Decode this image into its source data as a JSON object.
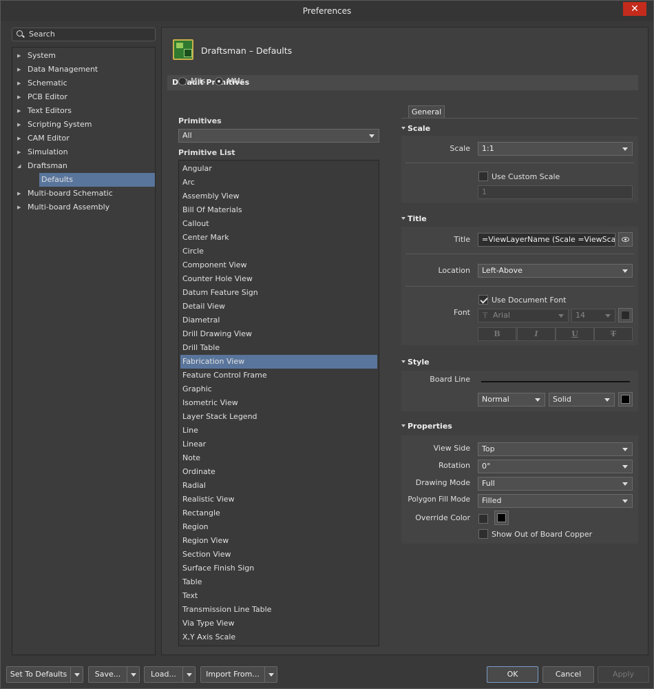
{
  "window": {
    "title": "Preferences",
    "close_label": "✕"
  },
  "search": {
    "placeholder": "Search"
  },
  "tree": {
    "items": [
      {
        "label": "System",
        "expanded": false
      },
      {
        "label": "Data Management",
        "expanded": false
      },
      {
        "label": "Schematic",
        "expanded": false
      },
      {
        "label": "PCB Editor",
        "expanded": false
      },
      {
        "label": "Text Editors",
        "expanded": false
      },
      {
        "label": "Scripting System",
        "expanded": false
      },
      {
        "label": "CAM Editor",
        "expanded": false
      },
      {
        "label": "Simulation",
        "expanded": false
      },
      {
        "label": "Draftsman",
        "expanded": true
      },
      {
        "label": "Defaults",
        "selected": true
      },
      {
        "label": "Multi-board Schematic",
        "expanded": false
      },
      {
        "label": "Multi-board Assembly",
        "expanded": false
      }
    ]
  },
  "page": {
    "title": "Draftsman – Defaults",
    "section": "Default Primitives",
    "units": {
      "mils": "Mils",
      "mms": "MMs",
      "selected": "MMs"
    },
    "primitives_label": "Primitives",
    "primitives_value": "All",
    "list_label": "Primitive List",
    "list": [
      "Angular",
      "Arc",
      "Assembly View",
      "Bill Of Materials",
      "Callout",
      "Center Mark",
      "Circle",
      "Component View",
      "Counter Hole View",
      "Datum Feature Sign",
      "Detail View",
      "Diametral",
      "Drill Drawing View",
      "Drill Table",
      "Fabrication View",
      "Feature Control Frame",
      "Graphic",
      "Isometric View",
      "Layer Stack Legend",
      "Line",
      "Linear",
      "Note",
      "Ordinate",
      "Radial",
      "Realistic View",
      "Rectangle",
      "Region",
      "Region View",
      "Section View",
      "Surface Finish Sign",
      "Table",
      "Text",
      "Transmission Line Table",
      "Via Type View",
      "X,Y Axis Scale"
    ],
    "list_selected": "Fabrication View"
  },
  "props": {
    "tab": "General",
    "scale": {
      "section": "Scale",
      "scale_label": "Scale",
      "scale_value": "1:1",
      "custom_label": "Use Custom Scale",
      "custom_checked": false,
      "custom_value": "1"
    },
    "title": {
      "section": "Title",
      "title_label": "Title",
      "title_value": "=ViewLayerName (Scale =ViewScale)",
      "location_label": "Location",
      "location_value": "Left-Above",
      "font_label": "Font",
      "use_doc_font_label": "Use Document Font",
      "use_doc_font_checked": true,
      "font_name": "Arial",
      "font_size": "14",
      "bold": "B",
      "italic": "I",
      "underline": "U",
      "strike": "T"
    },
    "style": {
      "section": "Style",
      "board_line_label": "Board Line",
      "weight_value": "Normal",
      "line_style_value": "Solid",
      "color": "#000000"
    },
    "properties": {
      "section": "Properties",
      "view_side_label": "View Side",
      "view_side_value": "Top",
      "rotation_label": "Rotation",
      "rotation_value": "0°",
      "drawing_mode_label": "Drawing Mode",
      "drawing_mode_value": "Full",
      "polygon_fill_label": "Polygon Fill Mode",
      "polygon_fill_value": "Filled",
      "override_color_label": "Override Color",
      "override_checked": false,
      "show_out_label": "Show Out of Board Copper",
      "show_out_checked": false
    }
  },
  "footer": {
    "set_defaults": "Set To Defaults",
    "save": "Save...",
    "load": "Load...",
    "import": "Import From...",
    "ok": "OK",
    "cancel": "Cancel",
    "apply": "Apply"
  },
  "colors": {
    "accent": "#59759c",
    "close": "#c42b1c"
  }
}
